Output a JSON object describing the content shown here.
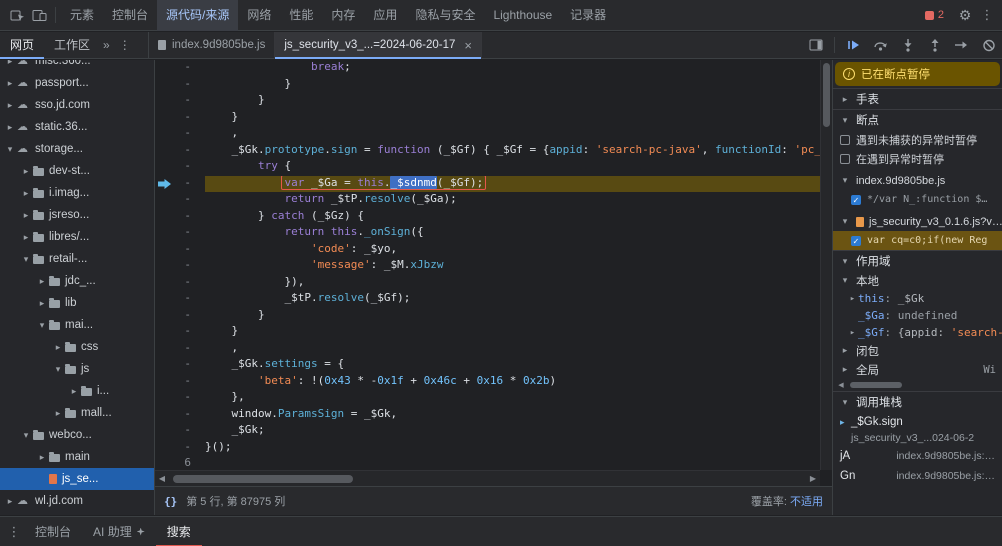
{
  "icons": {
    "collapsed": "▸",
    "expanded": "▾",
    "cloud": "☁",
    "more_v": "⋮",
    "gear": "⚙",
    "close": "×",
    "check": "✓",
    "info": "i",
    "format": "{}",
    "left": "◀",
    "right": "▶"
  },
  "top_toolbar": {
    "tabs": [
      "元素",
      "控制台",
      "源代码/来源",
      "网络",
      "性能",
      "内存",
      "应用",
      "隐私与安全",
      "Lighthouse",
      "记录器"
    ],
    "active_tab_index": 2,
    "error_badge": "2"
  },
  "nav_toolbar": {
    "panel_tabs": [
      "网页",
      "工作区"
    ],
    "active_panel_tab_index": 0,
    "overflow_chevron": "»",
    "file_tabs": [
      {
        "label": "index.9d9805be.js",
        "active": false
      },
      {
        "label": "js_security_v3_...=2024-06-20-17",
        "active": true,
        "close": "×"
      }
    ]
  },
  "file_tree": [
    {
      "depth": 1,
      "expand": "collapsed",
      "icon": "cloud",
      "label": "misc.360..."
    },
    {
      "depth": 1,
      "expand": "collapsed",
      "icon": "cloud",
      "label": "passport..."
    },
    {
      "depth": 1,
      "expand": "collapsed",
      "icon": "cloud",
      "label": "sso.jd.com"
    },
    {
      "depth": 1,
      "expand": "collapsed",
      "icon": "cloud",
      "label": "static.36..."
    },
    {
      "depth": 1,
      "expand": "expanded",
      "icon": "cloud",
      "label": "storage..."
    },
    {
      "depth": 2,
      "expand": "collapsed",
      "icon": "folder",
      "label": "dev-st..."
    },
    {
      "depth": 2,
      "expand": "collapsed",
      "icon": "folder",
      "label": "i.imag..."
    },
    {
      "depth": 2,
      "expand": "collapsed",
      "icon": "folder",
      "label": "jsreso..."
    },
    {
      "depth": 2,
      "expand": "collapsed",
      "icon": "folder",
      "label": "libres/..."
    },
    {
      "depth": 2,
      "expand": "expanded",
      "icon": "folder",
      "label": "retail-..."
    },
    {
      "depth": 3,
      "expand": "collapsed",
      "icon": "folder",
      "label": "jdc_..."
    },
    {
      "depth": 3,
      "expand": "collapsed",
      "icon": "folder",
      "label": "lib"
    },
    {
      "depth": 3,
      "expand": "expanded",
      "icon": "folder",
      "label": "mai..."
    },
    {
      "depth": 4,
      "expand": "collapsed",
      "icon": "folder",
      "label": "css"
    },
    {
      "depth": 4,
      "expand": "expanded",
      "icon": "folder",
      "label": "js"
    },
    {
      "depth": 5,
      "expand": "collapsed",
      "icon": "folder",
      "label": "i..."
    },
    {
      "depth": 4,
      "expand": "collapsed",
      "icon": "folder",
      "label": "mall..."
    },
    {
      "depth": 2,
      "expand": "expanded",
      "icon": "folder",
      "label": "webco..."
    },
    {
      "depth": 3,
      "expand": "collapsed",
      "icon": "folder",
      "label": "main"
    },
    {
      "depth": 3,
      "expand": "none",
      "icon": "file",
      "label": "js_se...",
      "selected": true
    },
    {
      "depth": 1,
      "expand": "collapsed",
      "icon": "cloud",
      "label": "wl.jd.com"
    }
  ],
  "editor": {
    "gutter_mark": "-",
    "lines": [
      {
        "i": 16,
        "t": [
          [
            "k",
            "break"
          ],
          [
            "d",
            ";"
          ]
        ]
      },
      {
        "i": 12,
        "t": [
          [
            "d",
            "}"
          ]
        ]
      },
      {
        "i": 8,
        "t": [
          [
            "d",
            "}"
          ]
        ]
      },
      {
        "i": 4,
        "t": [
          [
            "d",
            "}"
          ]
        ]
      },
      {
        "i": 4,
        "t": [
          [
            "d",
            ","
          ]
        ]
      },
      {
        "i": 4,
        "t": [
          [
            "d",
            "_$Gk."
          ],
          [
            "p",
            "prototype"
          ],
          [
            "d",
            "."
          ],
          [
            "p",
            "sign"
          ],
          [
            "d",
            " = "
          ],
          [
            "k",
            "function"
          ],
          [
            "d",
            " (_$Gf) { _$Gf = {"
          ],
          [
            "p",
            "appid"
          ],
          [
            "d",
            ": "
          ],
          [
            "s",
            "'search-pc-java'"
          ],
          [
            "d",
            ", "
          ],
          [
            "p",
            "functionId"
          ],
          [
            "d",
            ": "
          ],
          [
            "s",
            "'pc_search_s"
          ]
        ]
      },
      {
        "i": 8,
        "t": [
          [
            "k",
            "try"
          ],
          [
            "d",
            " {"
          ]
        ]
      },
      {
        "i": 12,
        "cur": true,
        "exec": true,
        "box": true,
        "t": [
          [
            "k",
            "var"
          ],
          [
            "d",
            " _$Ga = "
          ],
          [
            "k",
            "this"
          ],
          [
            "d",
            "."
          ],
          [
            "sel",
            "_$sdnmd"
          ],
          [
            "d",
            "(_$Gf);"
          ]
        ]
      },
      {
        "i": 12,
        "t": [
          [
            "k",
            "return"
          ],
          [
            "d",
            " _$tP."
          ],
          [
            "p",
            "resolve"
          ],
          [
            "d",
            "(_$Ga);"
          ]
        ]
      },
      {
        "i": 8,
        "t": [
          [
            "d",
            "} "
          ],
          [
            "k",
            "catch"
          ],
          [
            "d",
            " (_$Gz) {"
          ]
        ]
      },
      {
        "i": 12,
        "t": [
          [
            "k",
            "return"
          ],
          [
            "d",
            " "
          ],
          [
            "k",
            "this"
          ],
          [
            "d",
            "."
          ],
          [
            "p",
            "_onSign"
          ],
          [
            "d",
            "({"
          ]
        ]
      },
      {
        "i": 16,
        "t": [
          [
            "s",
            "'code'"
          ],
          [
            "d",
            ": _$yo,"
          ]
        ]
      },
      {
        "i": 16,
        "t": [
          [
            "s",
            "'message'"
          ],
          [
            "d",
            ": _$M."
          ],
          [
            "p",
            "xJbzw"
          ]
        ]
      },
      {
        "i": 12,
        "t": [
          [
            "d",
            "}),"
          ]
        ]
      },
      {
        "i": 12,
        "t": [
          [
            "d",
            "_$tP."
          ],
          [
            "p",
            "resolve"
          ],
          [
            "d",
            "(_$Gf);"
          ]
        ]
      },
      {
        "i": 8,
        "t": [
          [
            "d",
            "}"
          ]
        ]
      },
      {
        "i": 4,
        "t": [
          [
            "d",
            "}"
          ]
        ]
      },
      {
        "i": 4,
        "t": [
          [
            "d",
            ","
          ]
        ]
      },
      {
        "i": 4,
        "t": [
          [
            "d",
            "_$Gk."
          ],
          [
            "p",
            "settings"
          ],
          [
            "d",
            " = {"
          ]
        ]
      },
      {
        "i": 8,
        "t": [
          [
            "s",
            "'beta'"
          ],
          [
            "d",
            ": !("
          ],
          [
            "n",
            "0x43"
          ],
          [
            "d",
            " * -"
          ],
          [
            "n",
            "0x1f"
          ],
          [
            "d",
            " + "
          ],
          [
            "n",
            "0x46c"
          ],
          [
            "d",
            " + "
          ],
          [
            "n",
            "0x16"
          ],
          [
            "d",
            " * "
          ],
          [
            "n",
            "0x2b"
          ],
          [
            "d",
            ")"
          ]
        ]
      },
      {
        "i": 4,
        "t": [
          [
            "d",
            "},"
          ]
        ]
      },
      {
        "i": 4,
        "t": [
          [
            "d",
            "window."
          ],
          [
            "p",
            "ParamsSign"
          ],
          [
            "d",
            " = _$Gk,"
          ]
        ]
      },
      {
        "i": 4,
        "t": [
          [
            "d",
            "_$Gk;"
          ]
        ]
      },
      {
        "i": 0,
        "t": [
          [
            "d",
            "}();"
          ]
        ]
      },
      {
        "g": "6",
        "i": 0,
        "t": []
      }
    ]
  },
  "status_bar": {
    "position": "第 5 行, 第 87975 列",
    "coverage_label": "覆盖率:",
    "coverage_value": "不适用"
  },
  "debugger": {
    "paused_banner": "已在断点暂停",
    "watch_label": "手表",
    "breakpoints": {
      "title": "断点",
      "pause_uncaught": "遇到未捕获的异常时暂停",
      "pause_caught": "在遇到异常时暂停",
      "groups": [
        {
          "file": "index.9d9805be.js",
          "icon": false,
          "entries": [
            {
              "checked": true,
              "snippet": "*/var N_:function $…",
              "hit": false
            }
          ]
        },
        {
          "file": "js_security_v3_0.1.6.js?v…",
          "icon": true,
          "entries": [
            {
              "checked": true,
              "snippet": "var cq=c0;if(new Reg",
              "hit": true
            }
          ]
        }
      ]
    },
    "scope": {
      "title": "作用域",
      "groups": [
        {
          "label": "本地",
          "expanded": true,
          "vars": [
            {
              "arrow": true,
              "name": "this",
              "value": "_$Gk",
              "kind": "obj"
            },
            {
              "arrow": false,
              "name": "_$Ga",
              "value": "undefined",
              "kind": "muted"
            },
            {
              "arrow": true,
              "name": "_$Gf",
              "value_prefix": "{appid: ",
              "value_string": "'search-p",
              "kind": "preview"
            }
          ]
        },
        {
          "label": "闭包",
          "expanded": false,
          "vars": []
        },
        {
          "label": "全局",
          "expanded": false,
          "right_value": "Wi",
          "vars": []
        }
      ]
    },
    "call_stack": {
      "title": "调用堆栈",
      "frames": [
        {
          "name": "_$Gk.sign",
          "location": "js_security_v3_...024-06-2",
          "active": true,
          "two_line": true
        },
        {
          "name": "jA",
          "location": "index.9d9805be.js:…"
        },
        {
          "name": "Gn",
          "location": "index.9d9805be.js:…"
        }
      ]
    }
  },
  "drawer": {
    "tabs": [
      {
        "label": "控制台"
      },
      {
        "label": "AI 助理",
        "sparkle": true
      },
      {
        "label": "搜索",
        "active": true
      }
    ]
  }
}
